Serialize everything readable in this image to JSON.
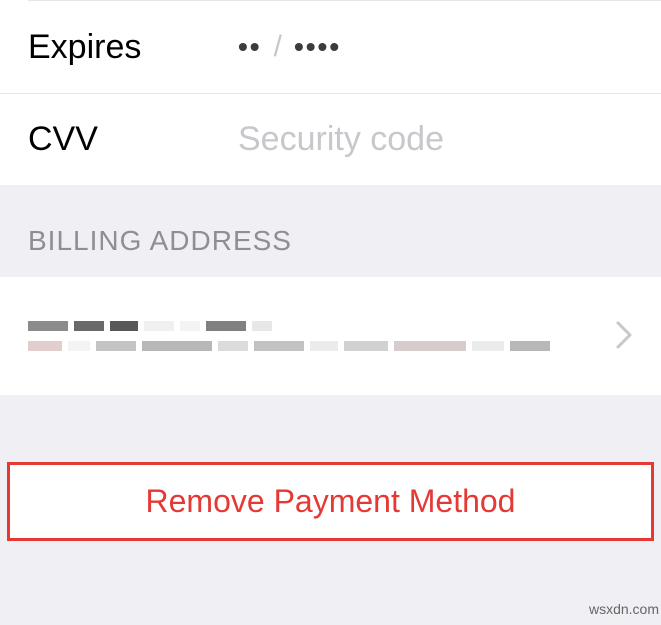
{
  "card": {
    "expires": {
      "label": "Expires",
      "mm_mask": "••",
      "separator": "/",
      "yyyy_mask": "••••"
    },
    "cvv": {
      "label": "CVV",
      "placeholder": "Security code"
    }
  },
  "billing": {
    "header": "BILLING ADDRESS"
  },
  "actions": {
    "remove": "Remove Payment Method"
  },
  "watermark": "wsxdn.com",
  "colors": {
    "destructive": "#e53935",
    "placeholder": "#c7c7cc",
    "section_header": "#8e8e93",
    "bg": "#efeff4"
  }
}
